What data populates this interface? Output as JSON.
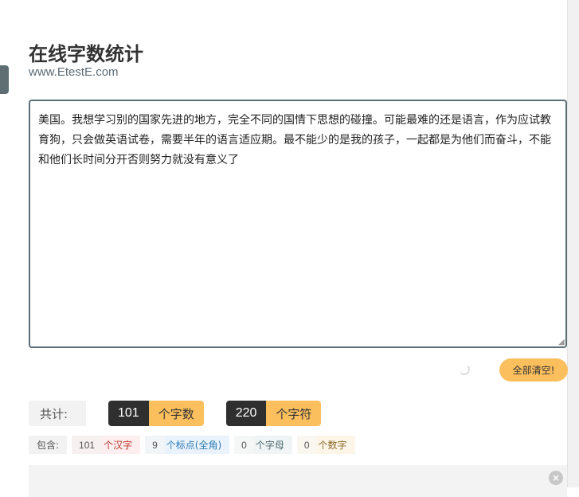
{
  "header": {
    "title": "在线字数统计",
    "subtitle": "www.EtestE.com"
  },
  "editor": {
    "text": "美国。我想学习别的国家先进的地方，完全不同的国情下思想的碰撞。可能最难的还是语言，作为应试教育狗，只会做英语试卷，需要半年的语言适应期。最不能少的是我的孩子，一起都是为他们而奋斗，不能和他们长时间分开否则努力就没有意义了"
  },
  "actions": {
    "clear_label": "全部清空!"
  },
  "stats": {
    "label": "共计:",
    "chars_count": "101",
    "chars_unit": "个字数",
    "symbols_count": "220",
    "symbols_unit": "个字符"
  },
  "contains": {
    "label": "包含:",
    "items": [
      {
        "count": "101",
        "unit": "个汉字"
      },
      {
        "count": "9",
        "unit": "个标点(全角)"
      },
      {
        "count": "0",
        "unit": "个字母"
      },
      {
        "count": "0",
        "unit": "个数字"
      }
    ]
  },
  "panel": {
    "close_icon": "close-icon",
    "close_glyph": "×"
  },
  "colors": {
    "accent": "#fbbf5d",
    "dark": "#2f2f2f",
    "border": "#5b6f74"
  }
}
